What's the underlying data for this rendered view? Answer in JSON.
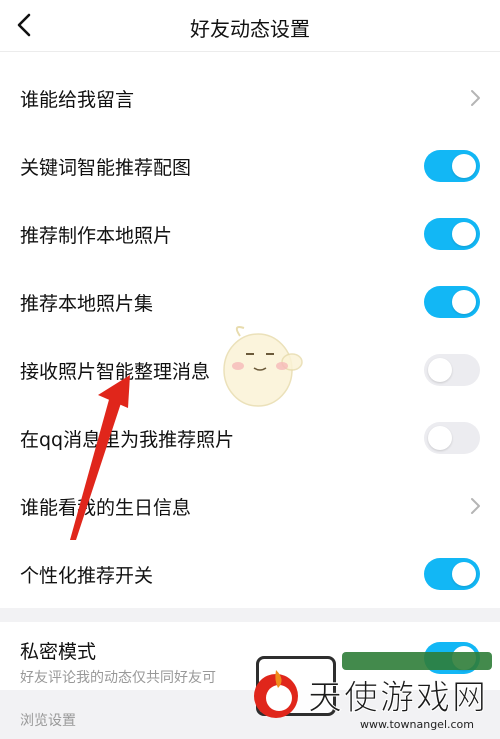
{
  "header": {
    "title": "好友动态设置"
  },
  "rows": [
    {
      "label": "谁能给我留言",
      "control": "chevron"
    },
    {
      "label": "关键词智能推荐配图",
      "control": "toggle",
      "on": true
    },
    {
      "label": "推荐制作本地照片",
      "control": "toggle",
      "on": true
    },
    {
      "label": "推荐本地照片集",
      "control": "toggle",
      "on": true
    },
    {
      "label": "接收照片智能整理消息",
      "control": "toggle",
      "on": false
    },
    {
      "label": "在qq消息里为我推荐照片",
      "control": "toggle",
      "on": false
    },
    {
      "label": "谁能看我的生日信息",
      "control": "chevron"
    },
    {
      "label": "个性化推荐开关",
      "control": "toggle",
      "on": true
    }
  ],
  "private_mode": {
    "title": "私密模式",
    "description": "好友评论我的动态仅共同好友可",
    "on": true
  },
  "browse_section": {
    "label": "浏览设置"
  },
  "watermark": {
    "text": "天使游戏网",
    "url": "www.townangel.com"
  },
  "colors": {
    "toggle_on": "#12b7f5",
    "toggle_off": "#ececf0",
    "annotation_arrow": "#e0261b"
  }
}
